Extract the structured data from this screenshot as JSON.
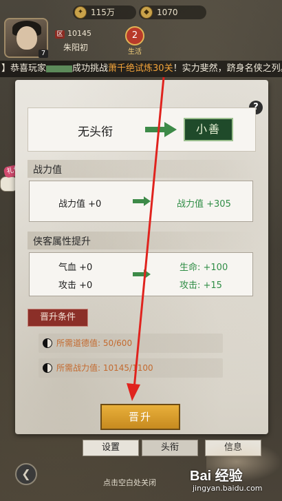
{
  "resources": {
    "silver": "115万",
    "gold": "1070"
  },
  "player": {
    "level": "7",
    "id": "10145",
    "name": "朱阳初",
    "vip_level": "2",
    "vip_label": "生活"
  },
  "marquee": {
    "prefix": "】恭喜玩家",
    "middle": "成功挑战",
    "highlight": "萧千绝试炼30关",
    "suffix": "！实力斐然，跻身名侠之列。"
  },
  "panel": {
    "help_label": "?",
    "current_title": "无头衔",
    "next_title": "小善",
    "combat_section": "战力值",
    "combat_left": "战力值 +0",
    "combat_right": "战力值 +305",
    "attr_section": "侠客属性提升",
    "hp_left": "气血 +0",
    "hp_right": "生命: +100",
    "atk_left": "攻击 +0",
    "atk_right": "攻击: +15",
    "condition_label": "晋升条件",
    "req_moral": "所需道德值: 50/600",
    "req_power": "所需战力值: 10145/1100",
    "promote_label": "晋升"
  },
  "tabs": [
    "设置",
    "头衔",
    "信息"
  ],
  "close_hint": "点击空白处关闭",
  "gift_label": "礼包",
  "watermark": {
    "logo": "Bai 经验",
    "url": "jingyan.baidu.com"
  },
  "colors": {
    "accent_green": "#2f8d45",
    "accent_orange": "#f3a43a",
    "condition_red": "#8b2f28",
    "promote_gold": "#e9b03b",
    "annotation_red": "#e0231e"
  }
}
